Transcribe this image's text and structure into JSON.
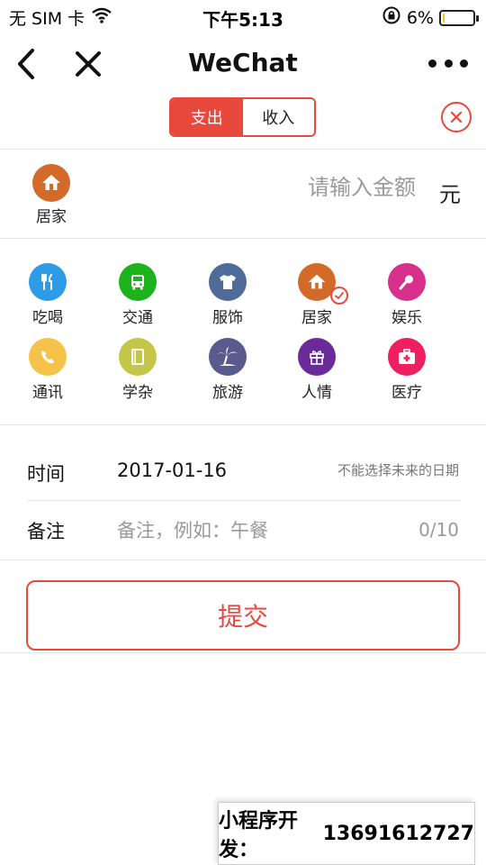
{
  "status_bar": {
    "carrier": "无 SIM 卡",
    "time": "下午5:13",
    "battery": "6%",
    "battery_level": 0.06
  },
  "nav": {
    "title": "WeChat",
    "back_icon": "chevron-left-icon",
    "close_icon": "close-icon",
    "more_icon": "more-dots-icon"
  },
  "tabs": {
    "expense": "支出",
    "income": "收入",
    "active": "expense"
  },
  "amount": {
    "category_label": "居家",
    "placeholder": "请输入金额",
    "currency": "元"
  },
  "categories": [
    {
      "label": "吃喝",
      "icon": "utensils-icon",
      "color": "#2e9be6"
    },
    {
      "label": "交通",
      "icon": "bus-icon",
      "color": "#1bb21b"
    },
    {
      "label": "服饰",
      "icon": "shirt-icon",
      "color": "#4f6b9a"
    },
    {
      "label": "居家",
      "icon": "home-icon",
      "color": "#d46a2a",
      "selected": true
    },
    {
      "label": "娱乐",
      "icon": "microphone-icon",
      "color": "#d6308a"
    },
    {
      "label": "通讯",
      "icon": "phone-icon",
      "color": "#f7c24a"
    },
    {
      "label": "学杂",
      "icon": "book-icon",
      "color": "#c4c64a"
    },
    {
      "label": "旅游",
      "icon": "palm-tree-icon",
      "color": "#5b5a8e"
    },
    {
      "label": "人情",
      "icon": "gift-icon",
      "color": "#6a2a9a"
    },
    {
      "label": "医疗",
      "icon": "medical-kit-icon",
      "color": "#ef1f61"
    }
  ],
  "form": {
    "time_label": "时间",
    "date_value": "2017-01-16",
    "date_hint": "不能选择未来的日期",
    "note_label": "备注",
    "note_placeholder": "备注，例如：午餐",
    "note_count": "0/10"
  },
  "submit_label": "提交",
  "promo": {
    "label": "小程序开发：",
    "phone": "13691612727"
  },
  "colors": {
    "accent": "#e8493c"
  }
}
